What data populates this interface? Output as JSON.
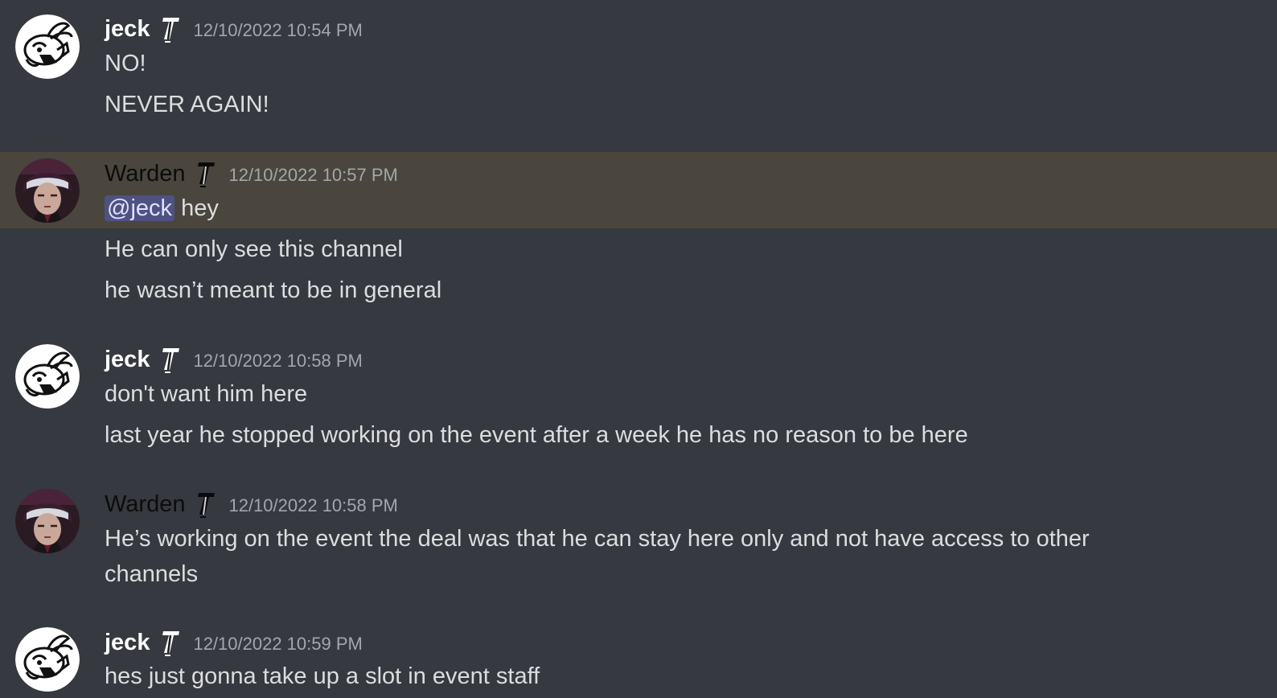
{
  "messages": [
    {
      "author": "jeck",
      "timestamp": "12/10/2022 10:54 PM",
      "avatar_icon": "jeck-rabbit-avatar",
      "lines": [
        "NO!",
        "NEVER AGAIN!"
      ]
    },
    {
      "author": "Warden",
      "timestamp": "12/10/2022 10:57 PM",
      "avatar_icon": "warden-character-avatar",
      "highlighted": true,
      "mention": "@jeck",
      "mention_rest": " hey",
      "lines": [
        "He can only see this channel",
        "he wasn’t meant to be in general"
      ]
    },
    {
      "author": "jeck",
      "timestamp": "12/10/2022 10:58 PM",
      "avatar_icon": "jeck-rabbit-avatar",
      "lines": [
        "don't want him here",
        "last year he stopped working on the event after a week he has no reason to be here"
      ]
    },
    {
      "author": "Warden",
      "timestamp": "12/10/2022 10:58 PM",
      "avatar_icon": "warden-character-avatar",
      "lines": [
        "He’s working on the event the deal was that he can stay here only and not have access to other channels"
      ]
    },
    {
      "author": "jeck",
      "timestamp": "12/10/2022 10:59 PM",
      "avatar_icon": "jeck-rabbit-avatar",
      "lines": [
        "hes just gonna take up a slot in event staff"
      ]
    }
  ],
  "colors": {
    "background": "#36393f",
    "highlight": "#4a463e",
    "text": "#dcddde",
    "timestamp": "#a3a6aa",
    "jeck_name": "#ffffff",
    "warden_name": "#0c0c0c",
    "mention_bg": "#5865f2"
  }
}
